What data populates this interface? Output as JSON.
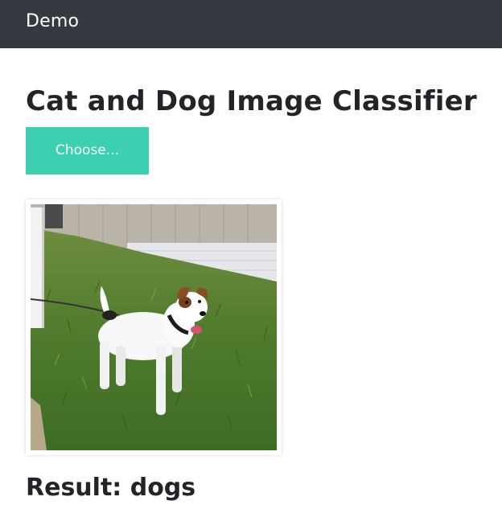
{
  "navbar": {
    "brand": "Demo"
  },
  "main": {
    "title": "Cat and Dog Image Classifier",
    "choose_label": "Choose...",
    "result_label": "Result: dogs"
  },
  "colors": {
    "navbar_bg": "#343a40",
    "button_bg": "#3ccfb0",
    "text": "#212529"
  }
}
